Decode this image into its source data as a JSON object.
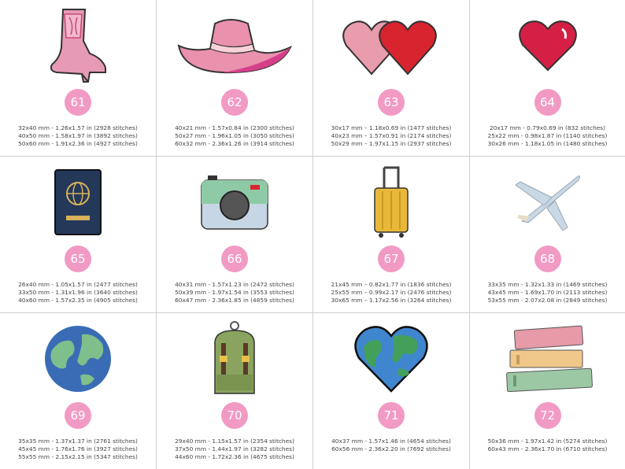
{
  "items": [
    {
      "number": "61",
      "icon": "cowboy-boot",
      "specs": [
        "32x40 mm - 1.26x1.57 in (2928 stitches)",
        "40x50 mm - 1.58x1.97 in (3892 stitches)",
        "50x60 mm - 1.91x2.36 in (4927 stitches)"
      ]
    },
    {
      "number": "62",
      "icon": "cowboy-hat",
      "specs": [
        "40x21 mm - 1.57x0.84 in (2300 stitches)",
        "50x27 mm - 1.96x1.05 in (3050 stitches)",
        "60x32 mm - 2.36x1.26 in (3914 stitches)"
      ]
    },
    {
      "number": "63",
      "icon": "two-hearts",
      "specs": [
        "30x17 mm – 1.18x0.69 in (1477 stitches)",
        "40x23 mm – 1.57x0.91 in (2174 stitches)",
        "50x29 mm – 1.97x1.15 in (2937 stitches)"
      ]
    },
    {
      "number": "64",
      "icon": "heart",
      "specs": [
        "20x17 mm - 0.79x0.69 in (832 stitches)",
        "25x22 mm - 0.98x1.87 in (1140 stitches)",
        "30x26 mm - 1.18x1.05 in (1480 stitches)"
      ]
    },
    {
      "number": "65",
      "icon": "passport",
      "specs": [
        "26x40 mm - 1.05x1.57 in (2477 stitches)",
        "33x50 mm - 1.31x1.96 in (3640 stitches)",
        "40x60 mm - 1.57x2.35 in (4905 stitches)"
      ]
    },
    {
      "number": "66",
      "icon": "camera",
      "specs": [
        "40x31 mm - 1.57x1.23 in (2472 stitches)",
        "50x39 mm - 1.97x1.54 in (3553 stitches)",
        "60x47 mm - 2.36x1.85 in (4859 stitches)"
      ]
    },
    {
      "number": "67",
      "icon": "suitcase",
      "specs": [
        "21x45 mm – 0.82x1.77 in (1836 stitches)",
        "25x55 mm – 0.99x2.17 in (2476 stitches)",
        "30x65 mm – 1.17x2.56 in (3264 stitches)"
      ]
    },
    {
      "number": "68",
      "icon": "airplane",
      "specs": [
        "33x35 mm - 1.32x1.33 in (1469 stitches)",
        "43x45 mm - 1.69x1.70 in (2113 stitches)",
        "53x55 mm - 2.07x2.08 in (2849 stitches)"
      ]
    },
    {
      "number": "69",
      "icon": "globe",
      "specs": [
        "35x35 mm - 1.37x1.37 in (2761 stitches)",
        "45x45 mm - 1.76x1.76 in (3927 stitches)",
        "55x55 mm - 2.15x2.15 in (5347 stitches)"
      ]
    },
    {
      "number": "70",
      "icon": "backpack",
      "specs": [
        "29x40 mm - 1.15x1.57 in (2354 stitches)",
        "37x50 mm - 1.44x1.97 in (3282 stitches)",
        "44x60 mm - 1.72x2.36 in (4675 stitches)"
      ]
    },
    {
      "number": "71",
      "icon": "heart-globe",
      "specs": [
        "40x37 mm - 1.57x1.46 in (4654 stitches)",
        "60x56 mm - 2.36x2.20 in (7692 stitches)"
      ]
    },
    {
      "number": "72",
      "icon": "stack-of-books",
      "specs": [
        "50x36 mm - 1.97x1.42 in (5274 stitches)",
        "60x43 mm - 2.36x1.70 in (6710 stitches)"
      ]
    }
  ]
}
